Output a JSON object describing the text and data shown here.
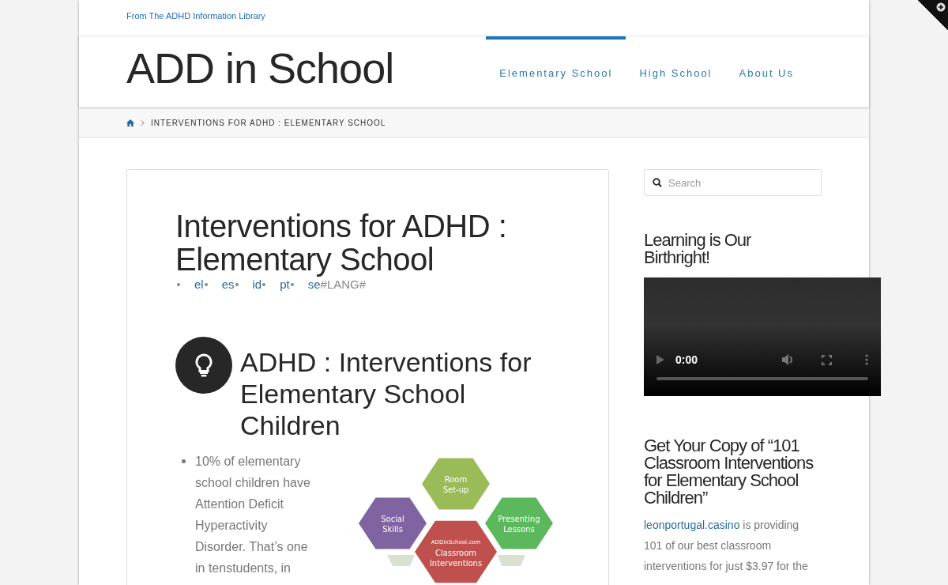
{
  "topbar": {
    "tagline": "From The ADHD Information Library"
  },
  "header": {
    "site_title": "ADD in School",
    "nav": [
      {
        "label": "Elementary School",
        "selected": true
      },
      {
        "label": "High School",
        "selected": false
      },
      {
        "label": "About Us",
        "selected": false
      }
    ]
  },
  "breadcrumb": {
    "current": "INTERVENTIONS FOR ADHD : ELEMENTARY SCHOOL"
  },
  "article": {
    "title": "Interventions for ADHD : Elementary School",
    "languages": [
      "el",
      "es",
      "id",
      "pt",
      "se"
    ],
    "languages_suffix": "#LANG#",
    "section_heading": "ADHD : Interventions for Elementary School Children",
    "bullets": [
      "10% of elementary school children have Attention Deficit Hyperactivity Disorder. That’s one in tenstudents, in"
    ],
    "infographic": {
      "hexagons": [
        {
          "lines": [
            "Room",
            "Set-up"
          ],
          "color": "#9bbb59"
        },
        {
          "lines": [
            "Social",
            "Skills"
          ],
          "color": "#8064a2"
        },
        {
          "lines": [
            "Presenting",
            "Lessons"
          ],
          "color": "#5cb85c"
        },
        {
          "lines": [
            "ADDinSchool.com",
            "Classroom",
            "Interventions"
          ],
          "color": "#c0504d"
        }
      ]
    }
  },
  "sidebar": {
    "search": {
      "placeholder": "Search"
    },
    "video_heading": "Learning is Our Birthright!",
    "video": {
      "time": "0:00"
    },
    "promo_heading": "Get Your Copy of “101 Classroom Interventions for Elementary School Children”",
    "promo_link": "leonportugal.casino",
    "promo_text": " is providing 101 of our best classroom interventions for just $3.97 for the"
  }
}
